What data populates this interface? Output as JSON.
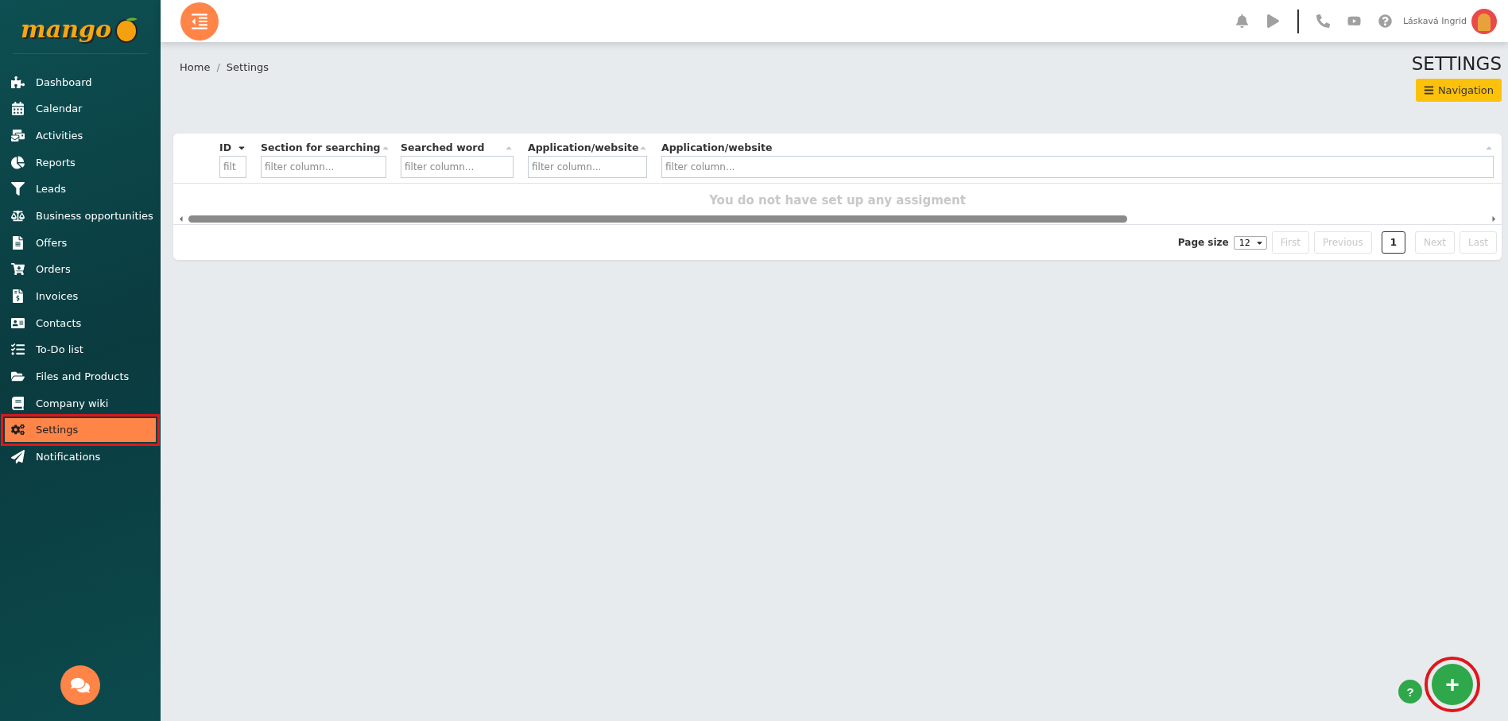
{
  "logo": {
    "text": "mango"
  },
  "sidebar": {
    "items": [
      {
        "label": "Dashboard",
        "selected": false,
        "highlighted": false
      },
      {
        "label": "Calendar",
        "selected": false,
        "highlighted": false
      },
      {
        "label": "Activities",
        "selected": false,
        "highlighted": false
      },
      {
        "label": "Reports",
        "selected": false,
        "highlighted": false
      },
      {
        "label": "Leads",
        "selected": false,
        "highlighted": false
      },
      {
        "label": "Business opportunities",
        "selected": false,
        "highlighted": false
      },
      {
        "label": "Offers",
        "selected": false,
        "highlighted": false
      },
      {
        "label": "Orders",
        "selected": false,
        "highlighted": false
      },
      {
        "label": "Invoices",
        "selected": false,
        "highlighted": false
      },
      {
        "label": "Contacts",
        "selected": false,
        "highlighted": false
      },
      {
        "label": "To-Do list",
        "selected": false,
        "highlighted": false
      },
      {
        "label": "Files and Products",
        "selected": false,
        "highlighted": false
      },
      {
        "label": "Company wiki",
        "selected": false,
        "highlighted": false
      },
      {
        "label": "Settings",
        "selected": true,
        "highlighted": true
      },
      {
        "label": "Notifications",
        "selected": false,
        "highlighted": false
      }
    ]
  },
  "header": {
    "user": "Láskavá Ingrid"
  },
  "breadcrumb": [
    "Home",
    "Settings"
  ],
  "breadcrumb_separator": "/",
  "page_title": "SETTINGS",
  "navigation_button": "Navigation",
  "table": {
    "columns": [
      {
        "label": "ID",
        "placeholder": "filt",
        "sorted": true
      },
      {
        "label": "Section for searching",
        "placeholder": "filter column...",
        "sorted": false
      },
      {
        "label": "Searched word",
        "placeholder": "filter column...",
        "sorted": false
      },
      {
        "label": "Application/website",
        "placeholder": "filter column...",
        "sorted": false
      },
      {
        "label": "Application/website",
        "placeholder": "filter column...",
        "sorted": false
      }
    ],
    "empty_message": "You do not have set up any assigment"
  },
  "pagination": {
    "page_size_label": "Page size",
    "page_size": "12",
    "buttons": [
      {
        "label": "First",
        "kind": "nav",
        "selected": false
      },
      {
        "label": "Previous",
        "kind": "nav",
        "selected": false
      },
      {
        "label": "1",
        "kind": "page",
        "selected": true
      },
      {
        "label": "Next",
        "kind": "nav",
        "selected": false
      },
      {
        "label": "Last",
        "kind": "nav",
        "selected": false
      }
    ]
  },
  "add_button": {
    "label": "+",
    "highlighted": true
  },
  "help_button": {
    "label": "?"
  }
}
